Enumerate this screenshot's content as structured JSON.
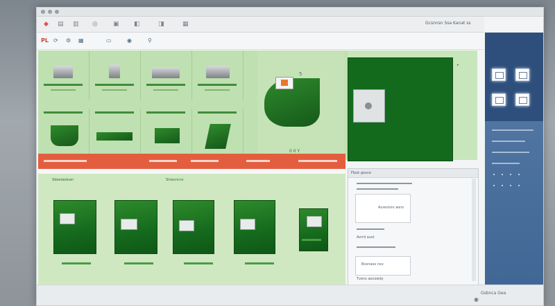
{
  "header": {
    "brand": "PL",
    "right_text": "Gcsnnsn Ssa Kanat ss"
  },
  "panel_mid": {
    "caption": "0 0 Y"
  },
  "top_labels": [
    "Glonalvecaus",
    "ooaaa vecw",
    "veenawou ow"
  ],
  "orange_bar": {
    "text": "D Y S"
  },
  "dialog": {
    "title": "Fbuk gouce",
    "items": [
      "Aurenivin wers",
      "Avrrd aust",
      "Bcenaes nov",
      "Tvens aecowdy"
    ]
  },
  "bottom_grid": {
    "header_left": "Sdeedaduen",
    "header_right": "Slnevncns"
  },
  "footer": {
    "right_text": "Gsbnca Gea",
    "icon": "fab-icon"
  }
}
